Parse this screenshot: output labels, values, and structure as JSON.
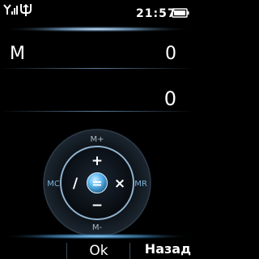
{
  "status_bar": {
    "time": "21:57",
    "signal_icon": "signal-strength-icon",
    "usb_icon": "usb-connection-icon",
    "battery_icon": "battery-icon"
  },
  "calculator": {
    "memory_label": "M",
    "memory_value": "0",
    "display_value": "0"
  },
  "pad": {
    "memory_plus": "M+",
    "memory_minus": "M-",
    "memory_clear": "MC",
    "memory_recall": "MR",
    "add": "+",
    "subtract": "−",
    "divide": "/",
    "multiply": "×",
    "equals": "="
  },
  "softkeys": {
    "ok": "Ok",
    "back": "Назад"
  },
  "colors": {
    "accent": "#5fb8f0",
    "ring": "#4a6478",
    "background": "#000000"
  }
}
